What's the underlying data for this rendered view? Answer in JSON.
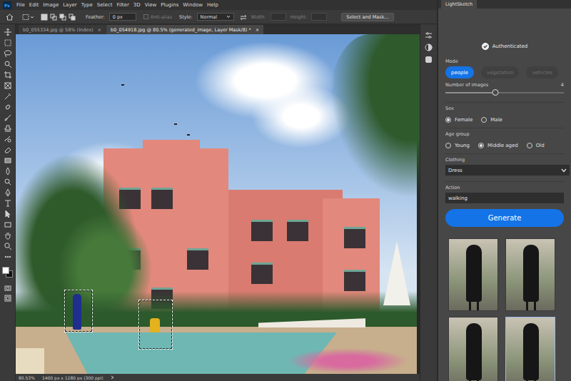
{
  "app": {
    "logo": "Ps"
  },
  "menu": [
    "File",
    "Edit",
    "Image",
    "Layer",
    "Type",
    "Select",
    "Filter",
    "3D",
    "View",
    "Plugins",
    "Window",
    "Help"
  ],
  "options_bar": {
    "feather_label": "Feather:",
    "feather_value": "0 px",
    "anti_alias": {
      "label": "Anti-alias",
      "disabled": true
    },
    "style_label": "Style:",
    "style_value": "Normal",
    "width": {
      "label": "Width:",
      "disabled": true
    },
    "height": {
      "label": "Height:",
      "disabled": true
    },
    "select_mask": "Select and Mask..."
  },
  "swatches": [
    {
      "color": "#ffffff"
    },
    {
      "color": "#111111"
    }
  ],
  "doc_tabs": [
    {
      "label": "b0_055334.jpg @ 58% (Index)",
      "close": "×",
      "selected": false
    },
    {
      "label": "b0_054918.jpg @ 80.5% (generated_image, Layer Mask/8) *",
      "close": "×",
      "selected": true
    }
  ],
  "status_bar": {
    "zoom": "80.53%",
    "size": "1400 px x 1280 px (300 ppi)"
  },
  "panel": {
    "tab": "LightSketch",
    "auth": {
      "label": "Authenticated",
      "checked": true
    },
    "mode": {
      "label": "Mode",
      "options": [
        {
          "label": "people",
          "selected": true
        },
        {
          "label": "vegetation",
          "selected": false
        },
        {
          "label": "vehicles",
          "selected": false
        }
      ]
    },
    "images": {
      "label": "Number of images",
      "value": "4",
      "level": 0.42
    },
    "sex": {
      "label": "Sex",
      "options": [
        {
          "label": "Female",
          "selected": true
        },
        {
          "label": "Male",
          "selected": false
        }
      ]
    },
    "age": {
      "label": "Age group",
      "options": [
        {
          "label": "Young",
          "selected": false
        },
        {
          "label": "Middle aged",
          "selected": true
        },
        {
          "label": "Old",
          "selected": false
        }
      ]
    },
    "clothing": {
      "label": "Clothing",
      "value": "Dress"
    },
    "action": {
      "label": "Action",
      "value": "walking"
    },
    "generate": "Generate",
    "results": [
      {
        "selected": false
      },
      {
        "selected": false
      },
      {
        "selected": false
      },
      {
        "selected": true
      }
    ]
  }
}
